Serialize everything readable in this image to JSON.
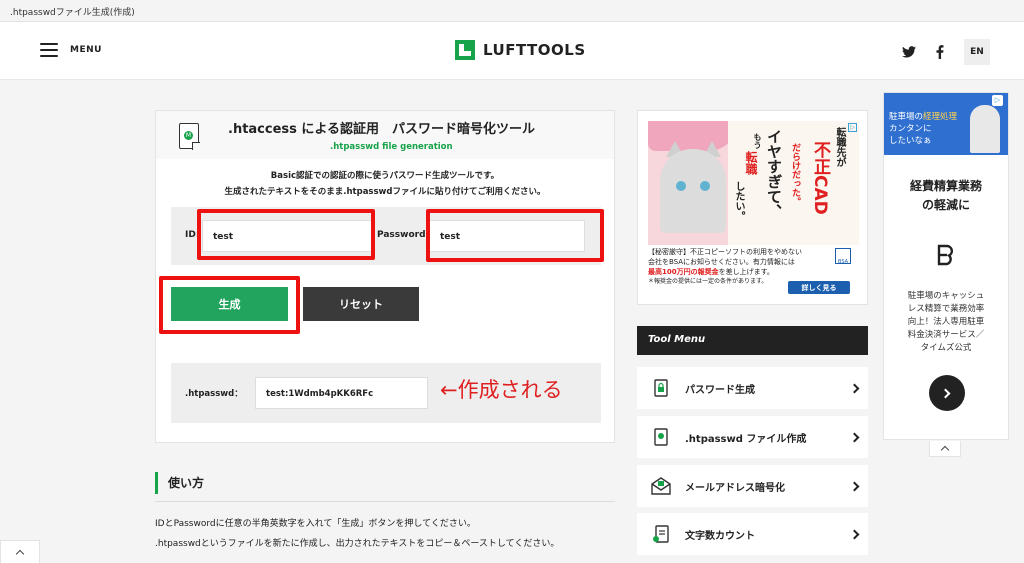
{
  "window": {
    "title": ".htpasswdファイル生成(作成)"
  },
  "header": {
    "menu_label": "MENU",
    "logo_text": "LUFTTOOLS",
    "lang_label": "EN"
  },
  "tool": {
    "title": ".htaccess による認証用　パスワード暗号化ツール",
    "subtitle": ".htpasswd file generation",
    "desc_line1": "Basic認証での認証の際に使うパスワード生成ツールです。",
    "desc_line2": "生成されたテキストをそのまま.htpasswdファイルに貼り付けてご利用ください。",
    "id_label": "ID:",
    "id_value": "test",
    "password_label": "Password:",
    "password_value": "test",
    "generate_button": "生成",
    "reset_button": "リセット",
    "result_label": ".htpasswd：",
    "result_value": "test:1Wdmb4pKK6RFc",
    "annotation": "←作成される"
  },
  "usage": {
    "title": "使い方",
    "line1": "IDとPasswordに任意の半角英数字を入れて「生成」ボタンを押してください。",
    "line2": ".htpasswdというファイルを新たに作成し、出力されたテキストをコピー＆ペーストしてください。"
  },
  "ad_bsa": {
    "headline_1": "不正CAD",
    "headline_2": "転職先が",
    "headline_3": "だらけだった。",
    "headline_4": "イヤすぎて、",
    "headline_5": "もう",
    "headline_6": "転職",
    "headline_7": "したい。",
    "copy_line1": "【秘密厳守】不正コピーソフトの利用をやめない",
    "copy_line2": "会社をBSAにお知らせください。有力情報には",
    "copy_line3_highlight": "最高100万円の報奨金",
    "copy_line3_rest": "を差し上げます。",
    "copy_line4": "＊報奨金の提供には一定の条件があります。",
    "button_label": "詳しく見る",
    "brand": "BSA"
  },
  "tool_menu": {
    "heading": "Tool Menu",
    "items": [
      {
        "label": "パスワード生成",
        "icon": "lock-file-icon"
      },
      {
        "label": ".htpasswd ファイル作成",
        "icon": "htpasswd-file-icon"
      },
      {
        "label": "メールアドレス暗号化",
        "icon": "mail-icon"
      },
      {
        "label": "文字数カウント",
        "icon": "count-file-icon"
      }
    ]
  },
  "ad_parking": {
    "top_line1a": "駐車場の",
    "top_line1b": "経理処理",
    "top_line2": "カンタンに",
    "top_line3": "したいなぁ",
    "title_line1": "経費精算業務",
    "title_line2": "の軽減に",
    "body_line1": "駐車場のキャッシュ",
    "body_line2": "レス精算で業務効率",
    "body_line3": "向上！法人専用駐車",
    "body_line4": "料金決済サービス／",
    "body_line5": "タイムズ公式"
  },
  "colors": {
    "brand_green": "#17a34a",
    "highlight_red": "#ee1111",
    "dark_button": "#3a3a3a"
  }
}
